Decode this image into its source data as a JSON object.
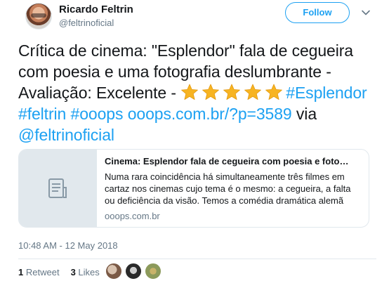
{
  "author": {
    "name": "Ricardo Feltrin",
    "handle": "@feltrinoficial",
    "follow_label": "Follow"
  },
  "tweet": {
    "text_part1": "Crítica de cinema: \"Esplendor\" fala de cegueira com poesia e uma fotografia deslumbrante - Avaliação: Excelente - ",
    "hashtags": "#Esplendor #feltrin #ooops",
    "link": "ooops.com.br/?p=3589",
    "via_label": "via",
    "mention": "@feltrinoficial",
    "star_count": 5
  },
  "card": {
    "title": "Cinema: Esplendor fala de cegueira com poesia e fotografia deslumbrante",
    "description": "Numa rara coincidência há simultaneamente três filmes em cartaz nos cinemas cujo tema é o mesmo: a cegueira, a falta ou deficiência da visão. Temos a comédia dramática alemã “De ...",
    "domain": "ooops.com.br",
    "icon": "document-icon"
  },
  "timestamp": "10:48 AM - 12 May 2018",
  "stats": {
    "retweets_count": "1",
    "retweets_label": "Retweet",
    "likes_count": "3",
    "likes_label": "Likes"
  },
  "colors": {
    "accent": "#1da1f2",
    "muted": "#657786",
    "star": "#f7b422"
  }
}
